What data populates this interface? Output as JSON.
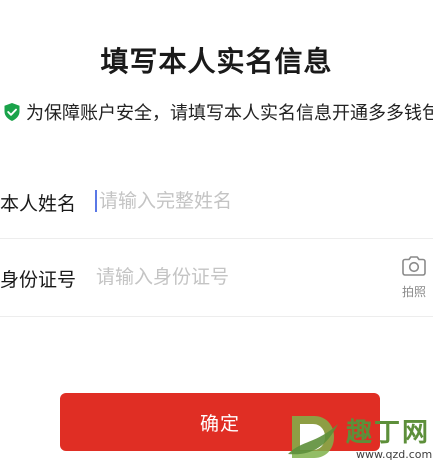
{
  "page": {
    "title": "填写本人实名信息",
    "notice": "为保障账户安全，请填写本人实名信息开通多多钱包"
  },
  "form": {
    "name": {
      "label": "本人姓名",
      "placeholder": "请输入完整姓名",
      "value": ""
    },
    "id_number": {
      "label": "身份证号",
      "placeholder": "请输入身份证号",
      "value": "",
      "camera_label": "拍照"
    }
  },
  "confirm_button": {
    "label": "确定",
    "color": "#e02e24"
  },
  "icons": {
    "notice_icon": "shield-check-icon",
    "camera_icon": "camera-icon"
  },
  "colors": {
    "accent": "#e02e24",
    "shield": "#1aa34a",
    "caret": "#5a78e6"
  },
  "watermark": {
    "text": "趣丁网",
    "url": "www.qzd.com"
  }
}
